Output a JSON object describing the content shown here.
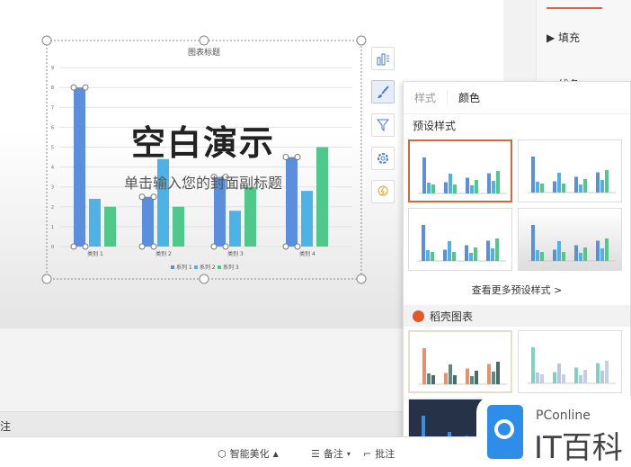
{
  "slide": {
    "title": "空白演示",
    "subtitle": "单击输入您的封面副标题"
  },
  "chart_data": {
    "type": "bar",
    "title": "图表标题",
    "categories": [
      "类别 1",
      "类别 2",
      "类别 3",
      "类别 4"
    ],
    "series": [
      {
        "name": "系列 1",
        "color": "#5b8fde",
        "values": [
          8,
          2.5,
          3.5,
          4.5
        ]
      },
      {
        "name": "系列 2",
        "color": "#4db3e6",
        "values": [
          2.4,
          4.4,
          1.8,
          2.8
        ]
      },
      {
        "name": "系列 3",
        "color": "#4ec98a",
        "values": [
          2,
          2,
          3,
          5
        ]
      }
    ],
    "ylim": [
      0,
      9
    ],
    "yticks": [
      "0",
      "1",
      "2",
      "3",
      "4",
      "5",
      "6",
      "7",
      "8",
      "9"
    ],
    "legend": "bottom",
    "grid": true
  },
  "props": {
    "fill": "填充",
    "line": "线条"
  },
  "popup": {
    "tab_style": "样式",
    "tab_color": "颜色",
    "preset_title": "预设样式",
    "more": "查看更多预设样式 >",
    "docer_title": "稻壳图表"
  },
  "notes": {
    "label": "注"
  },
  "status": {
    "beautify": "智能美化",
    "notes": "备注",
    "comment": "批注"
  },
  "watermark": {
    "brand": "PConline",
    "name": "IT百科"
  }
}
